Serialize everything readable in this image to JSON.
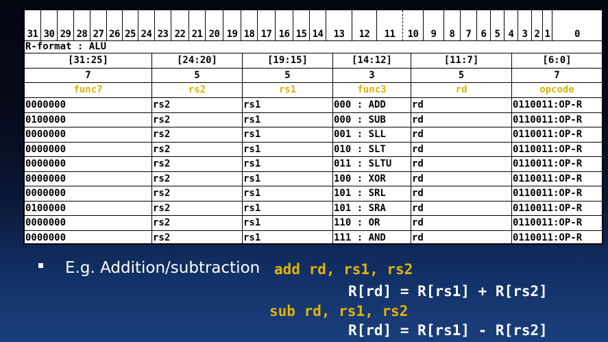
{
  "bit_numbers": [
    "31",
    "30",
    "29",
    "28",
    "27",
    "26",
    "25",
    "24",
    "23",
    "22",
    "21",
    "20",
    "19",
    "18",
    "17",
    "16",
    "15",
    "14",
    "13",
    "12",
    "11",
    "10",
    "9",
    "8",
    "7",
    "6",
    "5",
    "4",
    "3",
    "2",
    "1",
    "0"
  ],
  "format_label": "R-format : ALU",
  "fields": [
    {
      "range": "[31:25]",
      "width": "7",
      "name": "func7"
    },
    {
      "range": "[24:20]",
      "width": "5",
      "name": "rs2"
    },
    {
      "range": "[19:15]",
      "width": "5",
      "name": "rs1"
    },
    {
      "range": "[14:12]",
      "width": "3",
      "name": "func3"
    },
    {
      "range": "[11:7]",
      "width": "5",
      "name": "rd"
    },
    {
      "range": "[6:0]",
      "width": "7",
      "name": "opcode"
    }
  ],
  "rows": [
    [
      "0000000",
      "rs2",
      "rs1",
      "000 : ADD",
      "rd",
      "0110011:OP-R"
    ],
    [
      "0100000",
      "rs2",
      "rs1",
      "000 : SUB",
      "rd",
      "0110011:OP-R"
    ],
    [
      "0000000",
      "rs2",
      "rs1",
      "001 : SLL",
      "rd",
      "0110011:OP-R"
    ],
    [
      "0000000",
      "rs2",
      "rs1",
      "010 : SLT",
      "rd",
      "0110011:OP-R"
    ],
    [
      "0000000",
      "rs2",
      "rs1",
      "011 : SLTU",
      "rd",
      "0110011:OP-R"
    ],
    [
      "0000000",
      "rs2",
      "rs1",
      "100 : XOR",
      "rd",
      "0110011:OP-R"
    ],
    [
      "0000000",
      "rs2",
      "rs1",
      "101 : SRL",
      "rd",
      "0110011:OP-R"
    ],
    [
      "0100000",
      "rs2",
      "rs1",
      "101 : SRA",
      "rd",
      "0110011:OP-R"
    ],
    [
      "0000000",
      "rs2",
      "rs1",
      "110 : OR",
      "rd",
      "0110011:OP-R"
    ],
    [
      "0000000",
      "rs2",
      "rs1",
      "111 : AND",
      "rd",
      "0110011:OP-R"
    ]
  ],
  "note": {
    "bullet_text": "E.g. Addition/subtraction",
    "add_instr": "add rd, rs1, rs2",
    "add_semantics": "R[rd] = R[rs1] + R[rs2]",
    "sub_instr": "sub rd, rs1, rs2",
    "sub_semantics": "R[rd] = R[rs1] - R[rs2]"
  },
  "colors": {
    "field_name": "#d6b20a",
    "code_yellow": "#e8b400",
    "background_top": "#040610",
    "background_bottom": "#1a3f7c"
  }
}
